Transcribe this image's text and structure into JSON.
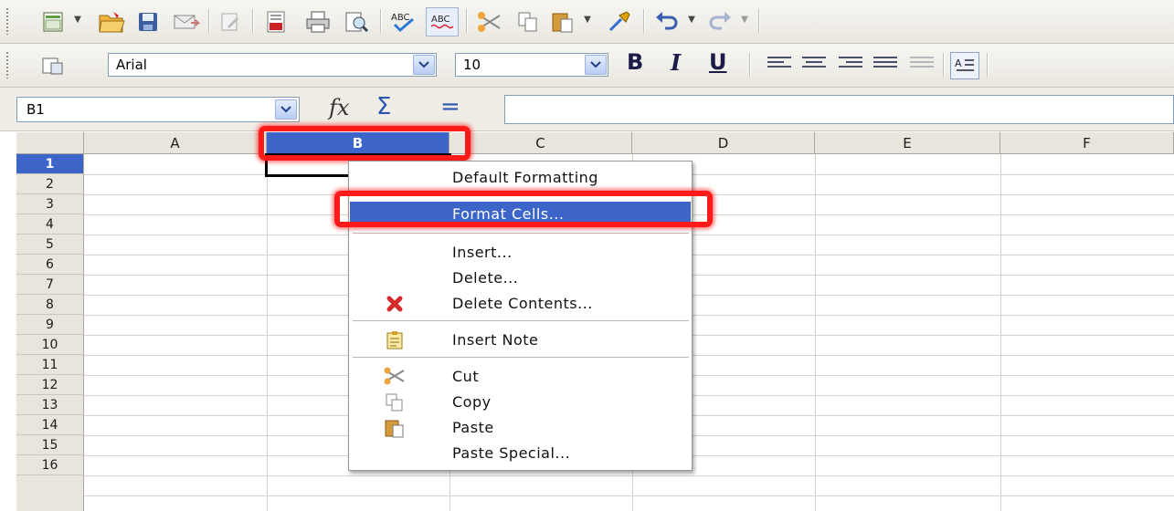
{
  "toolbar": {
    "font_name": "Arial",
    "font_size": "10",
    "bold": "B",
    "italic": "I",
    "underline": "U"
  },
  "formula_bar": {
    "cell_ref": "B1",
    "fx": "fx",
    "sum": "Σ",
    "equals": "="
  },
  "columns": [
    "A",
    "B",
    "C",
    "D",
    "E",
    "F"
  ],
  "rows": [
    "1",
    "2",
    "3",
    "4",
    "5",
    "6",
    "7",
    "8",
    "9",
    "10",
    "11",
    "12",
    "13",
    "14",
    "15",
    "16"
  ],
  "context_menu": {
    "default_formatting": "Default Formatting",
    "format_cells": "Format Cells...",
    "insert": "Insert...",
    "delete": "Delete...",
    "delete_contents": "Delete Contents...",
    "insert_note": "Insert Note",
    "cut": "Cut",
    "copy": "Copy",
    "paste": "Paste",
    "paste_special": "Paste Special..."
  },
  "colors": {
    "selection": "#3d64c8",
    "highlight_box": "#ff1a1a"
  }
}
